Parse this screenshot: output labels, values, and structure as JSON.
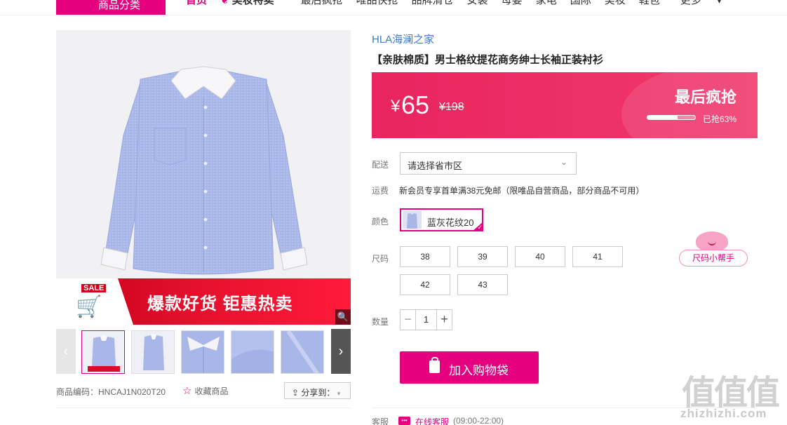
{
  "nav": {
    "category_label": "商品分类",
    "items": [
      "首页",
      "美妆特卖",
      "最后疯抢",
      "唯品快抢",
      "品牌清仓",
      "女装",
      "母婴",
      "家电",
      "国际",
      "美妆",
      "鞋包",
      "更多"
    ],
    "active_index": 0
  },
  "gallery": {
    "banner_badge": "SALE",
    "banner_text": "爆款好货 钜惠热卖",
    "thumbnail_count": 5,
    "selected_thumbnail": 0
  },
  "meta": {
    "product_code": "商品编码：HNCAJ1N020T20",
    "favorite_label": "收藏商品",
    "share_label": "分享到："
  },
  "product": {
    "brand": "HLA海澜之家",
    "title": "【亲肤棉质】男士格纹提花商务绅士长袖正装衬衫"
  },
  "price": {
    "currency": "¥",
    "current": "65",
    "original": "¥198",
    "flash_label": "最后疯抢",
    "sold_fraction": 0.63,
    "sold_text": "已抢63%"
  },
  "delivery": {
    "label": "配送",
    "placeholder": "请选择省市区"
  },
  "shipping": {
    "label": "运费",
    "text": "新会员专享首单满38元免邮（限唯品自营商品，部分商品不可用）"
  },
  "color": {
    "label": "颜色",
    "options": [
      "蓝灰花纹20"
    ],
    "selected": "蓝灰花纹20"
  },
  "size": {
    "label": "尺码",
    "options": [
      "38",
      "39",
      "40",
      "41",
      "42",
      "43"
    ],
    "helper_label": "尺码小帮手"
  },
  "quantity": {
    "label": "数量",
    "value": "1",
    "minus": "−",
    "plus": "+"
  },
  "cart": {
    "label": "加入购物袋"
  },
  "service": {
    "label": "客服",
    "link": "在线客服",
    "hours": "(09:00-22:00)"
  },
  "watermark": {
    "main": "值值值",
    "url": "zhizhizhi.com"
  },
  "colors": {
    "accent": "#e4007f",
    "price_band": "#ef2b64",
    "brand_link": "#3a7bd5"
  }
}
